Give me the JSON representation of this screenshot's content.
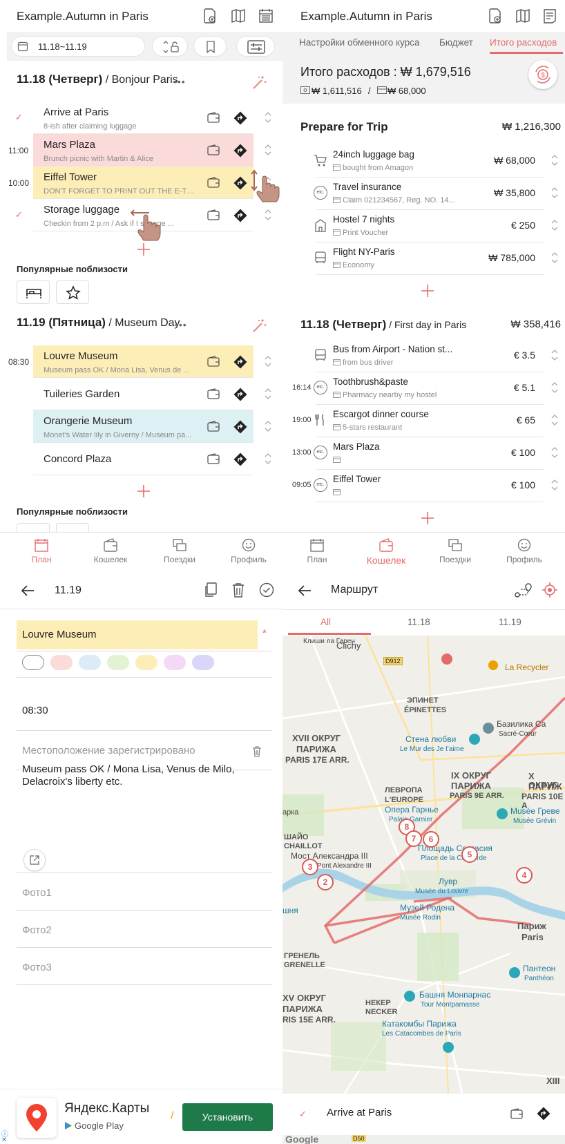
{
  "panel_plan": {
    "title": "Example.Autumn in Paris",
    "date_range": "11.18~11.19",
    "day1": {
      "date_label": "11.18 (Четверг)",
      "subtitle": " / Bonjour Paris",
      "more": "•••",
      "items": [
        {
          "time": "",
          "check": "✓",
          "title": "Arrive at Paris",
          "note": "8-ish after claiming luggage",
          "color": "#ffffff"
        },
        {
          "time": "11:00",
          "check": "",
          "title": "Mars Plaza",
          "note": "Brunch picnic with Martin & Alice",
          "color": "#fbdada"
        },
        {
          "time": "10:00",
          "check": "",
          "title": "Eiffel Tower",
          "note": "DON'T FORGET TO PRINT OUT THE E-TIC...",
          "color": "#fdeeb8"
        },
        {
          "time": "",
          "check": "✓",
          "title": "Storage luggage",
          "note": "Checkin from 2 p.m / Ask if I  storage ...",
          "color": "#ffffff"
        }
      ]
    },
    "nearby_label": "Популярные поблизости",
    "day2": {
      "date_label": "11.19 (Пятница)",
      "subtitle": " / Museum Day",
      "more": "•••",
      "items": [
        {
          "time": "08:30",
          "title": "Louvre Museum",
          "note": "Museum pass OK / Mona Lisa, Venus de ...",
          "color": "#fdeeb8"
        },
        {
          "time": "",
          "title": "Tuileries Garden",
          "note": "",
          "color": "#ffffff"
        },
        {
          "time": "",
          "title": "Orangerie Museum",
          "note": "Monet's Water lily in Giverny / Museum pa...",
          "color": "#ddf0f4"
        },
        {
          "time": "",
          "title": "Concord Plaza",
          "note": "",
          "color": "#ffffff"
        }
      ]
    },
    "nearby_label2": "Популярные поблизости",
    "nav": [
      "План",
      "Кошелек",
      "Поездки",
      "Профиль"
    ],
    "nav_active": 0
  },
  "panel_wallet": {
    "title": "Example.Autumn in Paris",
    "tabs": [
      "Настройки обменного курса",
      "Бюджет",
      "Итого расходов"
    ],
    "total_label": "Итого расходов : ₩ 1,679,516",
    "cash": "₩ 1,611,516",
    "sep": "/",
    "card": "₩ 68,000",
    "prepare": {
      "title": "Prepare for Trip",
      "total": "₩ 1,216,300"
    },
    "prep_items": [
      {
        "cat": "cart",
        "title": "24inch luggage bag",
        "sub": "bought from Amagon",
        "amount": "₩ 68,000"
      },
      {
        "cat": "etc",
        "title": "Travel insurance",
        "sub": "Claim 021234567, Reg. NO. 14...",
        "amount": "₩ 35,800"
      },
      {
        "cat": "hotel",
        "title": "Hostel 7 nights",
        "sub": "Print Voucher",
        "amount": "€ 250"
      },
      {
        "cat": "bus",
        "title": "Flight NY-Paris",
        "sub": "Economy",
        "amount": "₩ 785,000"
      }
    ],
    "day": {
      "title": "11.18 (Четверг)",
      "subtitle": " / First day in Paris",
      "total": "₩ 358,416"
    },
    "day_items": [
      {
        "time": "",
        "cat": "bus",
        "title": "Bus from Airport - Nation st...",
        "sub": "from bus driver",
        "amount": "€ 3.5"
      },
      {
        "time": "16:14",
        "cat": "etc",
        "title": "Toothbrush&paste",
        "sub": "Pharmacy nearby my hostel",
        "amount": "€ 5.1"
      },
      {
        "time": "19:00",
        "cat": "food",
        "title": "Escargot dinner course",
        "sub": "5-stars restaurant",
        "amount": "€ 65"
      },
      {
        "time": "13:00",
        "cat": "etc",
        "title": "Mars Plaza",
        "sub": "",
        "amount": "€ 100"
      },
      {
        "time": "09:05",
        "cat": "etc",
        "title": "Eiffel Tower",
        "sub": "",
        "amount": "€ 100"
      }
    ],
    "etc_label": "etc.",
    "nav": [
      "План",
      "Кошелек",
      "Поездки",
      "Профиль"
    ],
    "nav_active": 1
  },
  "panel_edit": {
    "date": "11.19",
    "title_value": "Louvre Museum",
    "required": "*",
    "time": "08:30",
    "location": "Местоположение зарегистрировано",
    "memo_line1": "Museum pass OK / Mona Lisa, Venus de Milo,",
    "memo_line2": "Delacroix's liberty etc.",
    "photos": [
      "Фото1",
      "Фото2",
      "Фото3"
    ],
    "swatches": [
      "#ffffff",
      "#fbdada",
      "#dcecf7",
      "#e4f2d4",
      "#fdeeb8",
      "#f4d9f7",
      "#d9d7f9"
    ],
    "ad": {
      "name": "Яндекс.Карты",
      "store": "Google Play",
      "button": "Установить"
    }
  },
  "panel_route": {
    "title": "Маршрут",
    "tabs": [
      "All",
      "11.18",
      "11.19"
    ],
    "map_labels": {
      "clichy": "Clichy",
      "clichy_top": "Клиши ла Гарен",
      "d912": "D912",
      "recycl": "La Recycler",
      "epinet1": "ЭПИНЕТ",
      "epinet2": "ÉPINETTES",
      "basil1": "Базилика Са",
      "basil2": "Sacré-Cœur",
      "wall1": "Стена любви",
      "wall2": "Le Mur des Je t'aime",
      "xvii1": "XVII ОКРУГ",
      "xvii2": "ПАРИЖА",
      "xvii3": "PARIS 17E ARR.",
      "ix1": "IX ОКРУГ",
      "ix2": "ПАРИЖА",
      "ix3": "PARIS 9E ARR.",
      "x1": "X ОКРУГ",
      "x2": "ПАРИЖ",
      "x3": "PARIS 10E A",
      "europe1": "ЛЕВРОПА",
      "europe2": "L'EUROPE",
      "opera1": "Опера Гарнье",
      "opera2": "Palais Garnier",
      "grevin1": "Musée Греве",
      "grevin2": "Musée Grévin",
      "arka": "арка",
      "chaillot1": "ШАЙО",
      "chaillot2": "CHAILLOT",
      "concorde1": "Площадь Согласия",
      "concorde2": "Place de la Concorde",
      "bridge1": "Мост Александра III",
      "bridge2": "Pont Alexandre III",
      "louvre1": "Лувр",
      "louvre2": "Musée du Louvre",
      "rodin1": "Музей Родена",
      "rodin2": "Musée Rodin",
      "shnya": "шня",
      "parizh1": "Париж",
      "parizh2": "Paris",
      "grenelle1": "ГРЕНЕЛЬ",
      "grenelle2": "GRENELLE",
      "pantheon1": "Пантеон",
      "pantheon2": "Panthéon",
      "xv1": "XV ОКРУГ",
      "xv2": "ПАРИЖА",
      "xv3": "RIS 15E ARR.",
      "necker1": "НЕКЕР",
      "necker2": "NECKER",
      "tower1": "Башня Монпарнас",
      "tower2": "Tour Montparnasse",
      "cata1": "Катакомбы Парижа",
      "cata2": "Les Catacombes de Paris",
      "xiii": "XIII",
      "google": "Google",
      "d50": "D50"
    },
    "pins": [
      "8",
      "7",
      "6",
      "5",
      "4",
      "3",
      "2"
    ],
    "bottom_check": "✓",
    "bottom_item": "Arrive at Paris"
  }
}
